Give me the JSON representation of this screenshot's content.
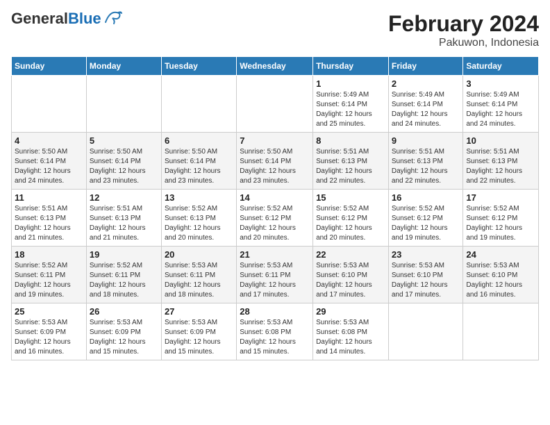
{
  "header": {
    "logo_general": "General",
    "logo_blue": "Blue",
    "title": "February 2024",
    "subtitle": "Pakuwon, Indonesia"
  },
  "weekdays": [
    "Sunday",
    "Monday",
    "Tuesday",
    "Wednesday",
    "Thursday",
    "Friday",
    "Saturday"
  ],
  "weeks": [
    [
      {
        "day": "",
        "info": ""
      },
      {
        "day": "",
        "info": ""
      },
      {
        "day": "",
        "info": ""
      },
      {
        "day": "",
        "info": ""
      },
      {
        "day": "1",
        "info": "Sunrise: 5:49 AM\nSunset: 6:14 PM\nDaylight: 12 hours\nand 25 minutes."
      },
      {
        "day": "2",
        "info": "Sunrise: 5:49 AM\nSunset: 6:14 PM\nDaylight: 12 hours\nand 24 minutes."
      },
      {
        "day": "3",
        "info": "Sunrise: 5:49 AM\nSunset: 6:14 PM\nDaylight: 12 hours\nand 24 minutes."
      }
    ],
    [
      {
        "day": "4",
        "info": "Sunrise: 5:50 AM\nSunset: 6:14 PM\nDaylight: 12 hours\nand 24 minutes."
      },
      {
        "day": "5",
        "info": "Sunrise: 5:50 AM\nSunset: 6:14 PM\nDaylight: 12 hours\nand 23 minutes."
      },
      {
        "day": "6",
        "info": "Sunrise: 5:50 AM\nSunset: 6:14 PM\nDaylight: 12 hours\nand 23 minutes."
      },
      {
        "day": "7",
        "info": "Sunrise: 5:50 AM\nSunset: 6:14 PM\nDaylight: 12 hours\nand 23 minutes."
      },
      {
        "day": "8",
        "info": "Sunrise: 5:51 AM\nSunset: 6:13 PM\nDaylight: 12 hours\nand 22 minutes."
      },
      {
        "day": "9",
        "info": "Sunrise: 5:51 AM\nSunset: 6:13 PM\nDaylight: 12 hours\nand 22 minutes."
      },
      {
        "day": "10",
        "info": "Sunrise: 5:51 AM\nSunset: 6:13 PM\nDaylight: 12 hours\nand 22 minutes."
      }
    ],
    [
      {
        "day": "11",
        "info": "Sunrise: 5:51 AM\nSunset: 6:13 PM\nDaylight: 12 hours\nand 21 minutes."
      },
      {
        "day": "12",
        "info": "Sunrise: 5:51 AM\nSunset: 6:13 PM\nDaylight: 12 hours\nand 21 minutes."
      },
      {
        "day": "13",
        "info": "Sunrise: 5:52 AM\nSunset: 6:13 PM\nDaylight: 12 hours\nand 20 minutes."
      },
      {
        "day": "14",
        "info": "Sunrise: 5:52 AM\nSunset: 6:12 PM\nDaylight: 12 hours\nand 20 minutes."
      },
      {
        "day": "15",
        "info": "Sunrise: 5:52 AM\nSunset: 6:12 PM\nDaylight: 12 hours\nand 20 minutes."
      },
      {
        "day": "16",
        "info": "Sunrise: 5:52 AM\nSunset: 6:12 PM\nDaylight: 12 hours\nand 19 minutes."
      },
      {
        "day": "17",
        "info": "Sunrise: 5:52 AM\nSunset: 6:12 PM\nDaylight: 12 hours\nand 19 minutes."
      }
    ],
    [
      {
        "day": "18",
        "info": "Sunrise: 5:52 AM\nSunset: 6:11 PM\nDaylight: 12 hours\nand 19 minutes."
      },
      {
        "day": "19",
        "info": "Sunrise: 5:52 AM\nSunset: 6:11 PM\nDaylight: 12 hours\nand 18 minutes."
      },
      {
        "day": "20",
        "info": "Sunrise: 5:53 AM\nSunset: 6:11 PM\nDaylight: 12 hours\nand 18 minutes."
      },
      {
        "day": "21",
        "info": "Sunrise: 5:53 AM\nSunset: 6:11 PM\nDaylight: 12 hours\nand 17 minutes."
      },
      {
        "day": "22",
        "info": "Sunrise: 5:53 AM\nSunset: 6:10 PM\nDaylight: 12 hours\nand 17 minutes."
      },
      {
        "day": "23",
        "info": "Sunrise: 5:53 AM\nSunset: 6:10 PM\nDaylight: 12 hours\nand 17 minutes."
      },
      {
        "day": "24",
        "info": "Sunrise: 5:53 AM\nSunset: 6:10 PM\nDaylight: 12 hours\nand 16 minutes."
      }
    ],
    [
      {
        "day": "25",
        "info": "Sunrise: 5:53 AM\nSunset: 6:09 PM\nDaylight: 12 hours\nand 16 minutes."
      },
      {
        "day": "26",
        "info": "Sunrise: 5:53 AM\nSunset: 6:09 PM\nDaylight: 12 hours\nand 15 minutes."
      },
      {
        "day": "27",
        "info": "Sunrise: 5:53 AM\nSunset: 6:09 PM\nDaylight: 12 hours\nand 15 minutes."
      },
      {
        "day": "28",
        "info": "Sunrise: 5:53 AM\nSunset: 6:08 PM\nDaylight: 12 hours\nand 15 minutes."
      },
      {
        "day": "29",
        "info": "Sunrise: 5:53 AM\nSunset: 6:08 PM\nDaylight: 12 hours\nand 14 minutes."
      },
      {
        "day": "",
        "info": ""
      },
      {
        "day": "",
        "info": ""
      }
    ]
  ]
}
